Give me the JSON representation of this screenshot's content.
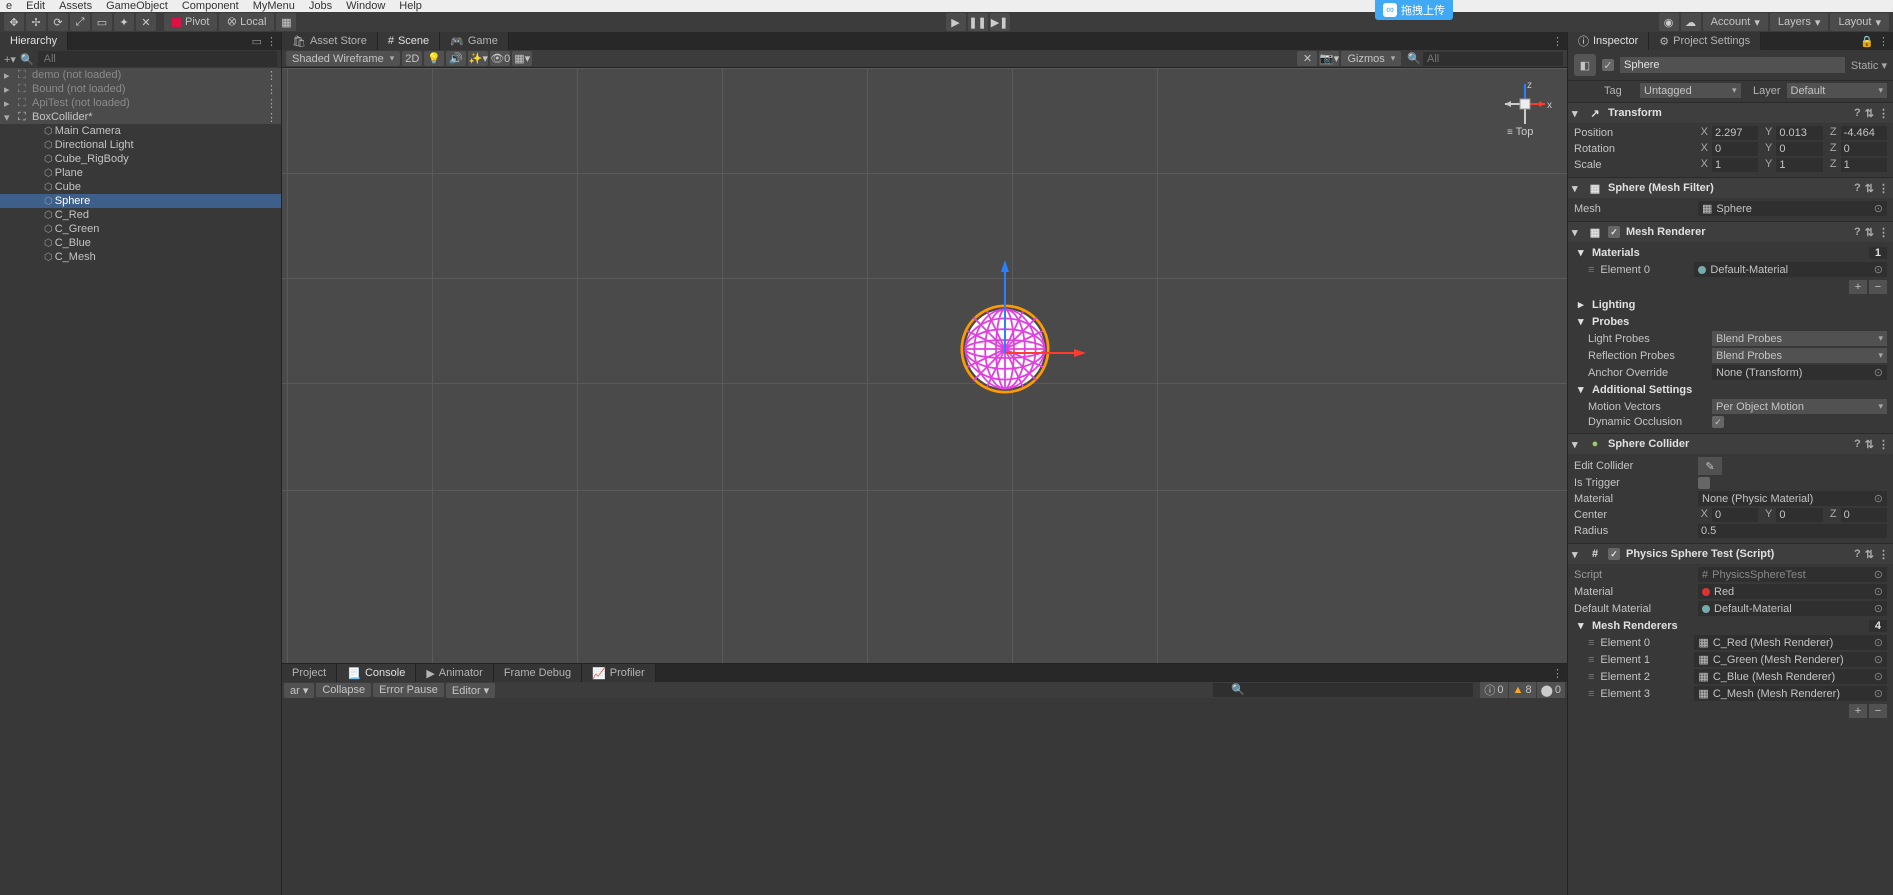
{
  "menu": [
    "e",
    "Edit",
    "Assets",
    "GameObject",
    "Component",
    "MyMenu",
    "Jobs",
    "Window",
    "Help"
  ],
  "toolbar": {
    "pivot": "Pivot",
    "local": "Local",
    "account": "Account",
    "layers": "Layers",
    "layout": "Layout"
  },
  "cloud_badge": "拖拽上传",
  "hierarchy": {
    "title": "Hierarchy",
    "search_placeholder": "All",
    "scenes": [
      {
        "name": "demo (not loaded)",
        "dim": true
      },
      {
        "name": "Bound (not loaded)",
        "dim": true
      },
      {
        "name": "ApiTest (not loaded)",
        "dim": true
      },
      {
        "name": "BoxCollider*",
        "dim": false,
        "expanded": true,
        "items": [
          "Main Camera",
          "Directional Light",
          "Cube_RigBody",
          "Plane",
          "Cube",
          "Sphere",
          "C_Red",
          "C_Green",
          "C_Blue",
          "C_Mesh"
        ],
        "selected": "Sphere"
      }
    ]
  },
  "scene_tabs": {
    "asset_store": "Asset Store",
    "scene": "Scene",
    "game": "Game"
  },
  "scene_toolbar": {
    "shading": "Shaded Wireframe",
    "mode2d": "2D",
    "hidden": "0",
    "gizmos": "Gizmos",
    "search_placeholder": "All"
  },
  "orient_labels": {
    "x": "x",
    "z": "z",
    "top": "Top"
  },
  "bottom": {
    "tabs": [
      "Project",
      "Console",
      "Animator",
      "Frame Debug",
      "Profiler"
    ],
    "active": 1,
    "toolbar": {
      "clear": "ar",
      "collapse": "Collapse",
      "errorpause": "Error Pause",
      "editor": "Editor"
    },
    "counts": {
      "info": "0",
      "warn": "8",
      "error": "0"
    }
  },
  "inspector": {
    "tab1": "Inspector",
    "tab2": "Project Settings",
    "object_name": "Sphere",
    "static": "Static",
    "tag_label": "Tag",
    "tag": "Untagged",
    "layer_label": "Layer",
    "layer": "Default",
    "transform": {
      "title": "Transform",
      "position": {
        "label": "Position",
        "x": "2.297",
        "y": "0.013",
        "z": "-4.464"
      },
      "rotation": {
        "label": "Rotation",
        "x": "0",
        "y": "0",
        "z": "0"
      },
      "scale": {
        "label": "Scale",
        "x": "1",
        "y": "1",
        "z": "1"
      }
    },
    "mesh_filter": {
      "title": "Sphere (Mesh Filter)",
      "mesh_label": "Mesh",
      "mesh": "Sphere"
    },
    "mesh_renderer": {
      "title": "Mesh Renderer",
      "materials_label": "Materials",
      "materials_count": "1",
      "element0_label": "Element 0",
      "element0": "Default-Material",
      "lighting": "Lighting",
      "probes": "Probes",
      "light_probes_label": "Light Probes",
      "light_probes": "Blend Probes",
      "refl_probes_label": "Reflection Probes",
      "refl_probes": "Blend Probes",
      "anchor_label": "Anchor Override",
      "anchor": "None (Transform)",
      "additional": "Additional Settings",
      "motion_label": "Motion Vectors",
      "motion": "Per Object Motion",
      "dynocc_label": "Dynamic Occlusion"
    },
    "sphere_collider": {
      "title": "Sphere Collider",
      "edit_label": "Edit Collider",
      "trigger_label": "Is Trigger",
      "material_label": "Material",
      "material": "None (Physic Material)",
      "center": {
        "label": "Center",
        "x": "0",
        "y": "0",
        "z": "0"
      },
      "radius_label": "Radius",
      "radius": "0.5"
    },
    "physics_test": {
      "title": "Physics Sphere Test (Script)",
      "script_label": "Script",
      "script": "PhysicsSphereTest",
      "material_label": "Material",
      "material": "Red",
      "defmat_label": "Default Material",
      "defmat": "Default-Material",
      "meshrend_label": "Mesh Renderers",
      "meshrend_count": "4",
      "elements": [
        {
          "label": "Element 0",
          "val": "C_Red (Mesh Renderer)"
        },
        {
          "label": "Element 1",
          "val": "C_Green (Mesh Renderer)"
        },
        {
          "label": "Element 2",
          "val": "C_Blue (Mesh Renderer)"
        },
        {
          "label": "Element 3",
          "val": "C_Mesh (Mesh Renderer)"
        }
      ]
    }
  }
}
